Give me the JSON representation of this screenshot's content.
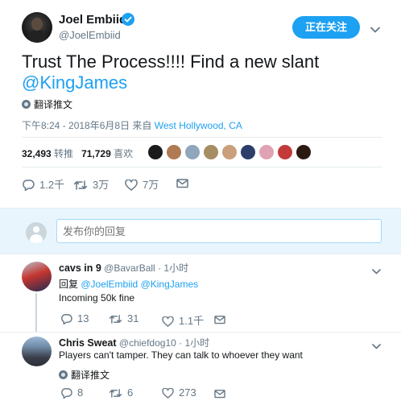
{
  "tweet": {
    "author_name": "Joel Embiid",
    "author_handle": "@JoelEmbiid",
    "follow_label": "正在关注",
    "text_prefix": "Trust The Process!!!! Find a new slant",
    "text_mention": "@KingJames",
    "translate_label": "翻译推文",
    "timestamp": "下午8:24 - 2018年6月8日 来自",
    "location": "West Hollywood, CA",
    "retweet_count": "32,493",
    "retweet_label": "转推",
    "like_count": "71,729",
    "like_label": "喜欢",
    "reply_action_count": "1.2千",
    "retweet_action_count": "3万",
    "like_action_count": "7万",
    "icons": [
      "verified-badge-icon",
      "chevron-down-icon",
      "globe-icon",
      "reply-icon",
      "retweet-icon",
      "heart-icon",
      "message-icon"
    ],
    "colors": {
      "accent": "#1da1f2",
      "muted": "#657786",
      "text": "#14171a"
    }
  },
  "reply_box": {
    "placeholder": "发布你的回复"
  },
  "replies": [
    {
      "name": "cavs in 9",
      "handle": "@BavarBall",
      "time": "· 1小时",
      "reply_to_label": "回复",
      "reply_to_mentions": "@JoelEmbiid @KingJames",
      "text": "Incoming 50k fine",
      "reply_count": "13",
      "retweet_count": "31",
      "like_count": "1.1千"
    },
    {
      "name": "Chris Sweat",
      "handle": "@chiefdog10",
      "time": "· 1小时",
      "text": "Players can't tamper. They can talk to whoever they want",
      "translate_label": "翻译推文",
      "reply_count": "8",
      "retweet_count": "6",
      "like_count": "273"
    }
  ]
}
